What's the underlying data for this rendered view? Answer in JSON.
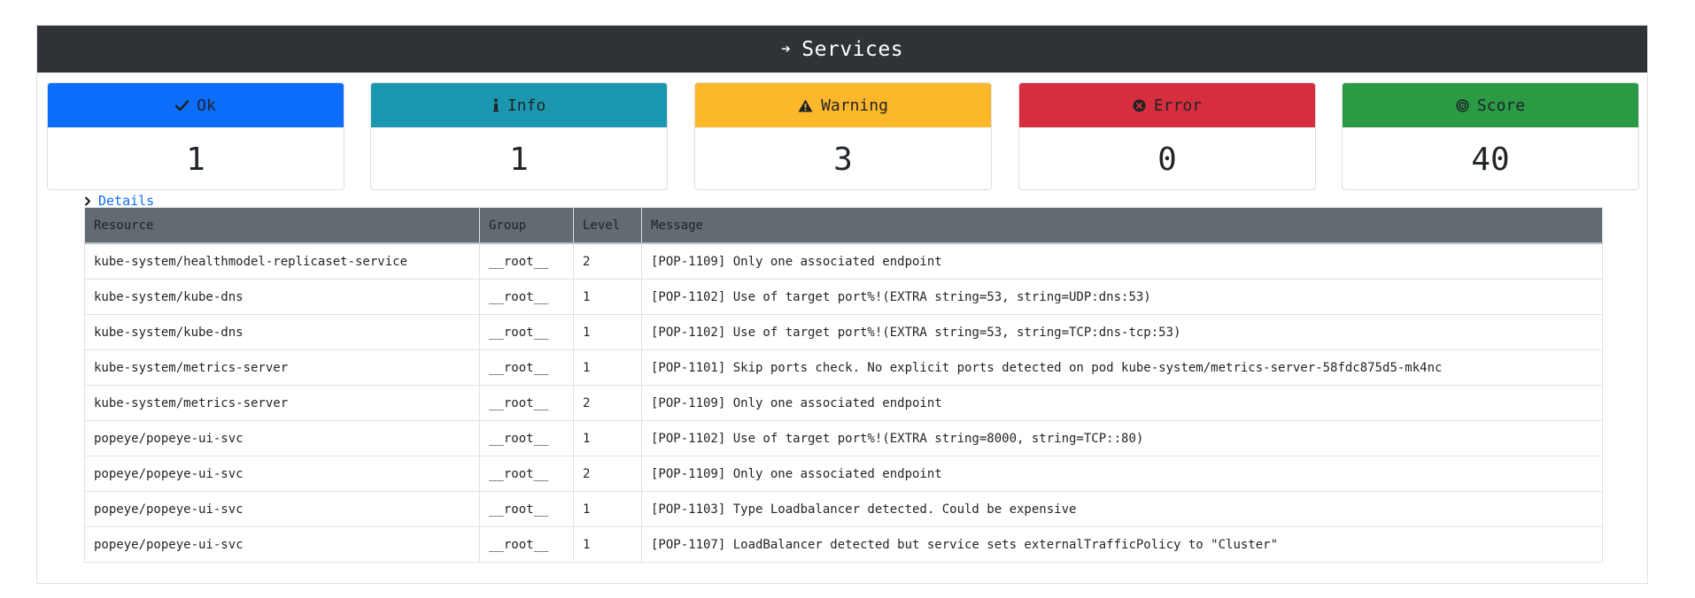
{
  "panel": {
    "title": "Services",
    "title_icon": "arrow-right-icon"
  },
  "cards": [
    {
      "label": "Ok",
      "value": "1",
      "icon": "check-icon",
      "color": "#0d6efd",
      "text_color": "#1f2326"
    },
    {
      "label": "Info",
      "value": "1",
      "icon": "info-icon",
      "color": "#1b98b0",
      "text_color": "#1f2326"
    },
    {
      "label": "Warning",
      "value": "3",
      "icon": "warning-triangle-icon",
      "color": "#fdb72b",
      "text_color": "#1f2326"
    },
    {
      "label": "Error",
      "value": "0",
      "icon": "circle-x-icon",
      "color": "#d62e3e",
      "text_color": "#1f2326"
    },
    {
      "label": "Score",
      "value": "40",
      "icon": "target-icon",
      "color": "#2a9a45",
      "text_color": "#1f2326"
    }
  ],
  "details": {
    "label": "Details",
    "icon": "chevron-right-icon"
  },
  "table": {
    "columns": [
      "Resource",
      "Group",
      "Level",
      "Message"
    ],
    "rows": [
      {
        "resource": "kube-system/healthmodel-replicaset-service",
        "group": "__root__",
        "level": "2",
        "message": "[POP-1109] Only one associated endpoint"
      },
      {
        "resource": "kube-system/kube-dns",
        "group": "__root__",
        "level": "1",
        "message": "[POP-1102] Use of target port%!(EXTRA string=53, string=UDP:dns:53)"
      },
      {
        "resource": "kube-system/kube-dns",
        "group": "__root__",
        "level": "1",
        "message": "[POP-1102] Use of target port%!(EXTRA string=53, string=TCP:dns-tcp:53)"
      },
      {
        "resource": "kube-system/metrics-server",
        "group": "__root__",
        "level": "1",
        "message": "[POP-1101] Skip ports check. No explicit ports detected on pod kube-system/metrics-server-58fdc875d5-mk4nc"
      },
      {
        "resource": "kube-system/metrics-server",
        "group": "__root__",
        "level": "2",
        "message": "[POP-1109] Only one associated endpoint"
      },
      {
        "resource": "popeye/popeye-ui-svc",
        "group": "__root__",
        "level": "1",
        "message": "[POP-1102] Use of target port%!(EXTRA string=8000, string=TCP::80)"
      },
      {
        "resource": "popeye/popeye-ui-svc",
        "group": "__root__",
        "level": "2",
        "message": "[POP-1109] Only one associated endpoint"
      },
      {
        "resource": "popeye/popeye-ui-svc",
        "group": "__root__",
        "level": "1",
        "message": "[POP-1103] Type Loadbalancer detected. Could be expensive"
      },
      {
        "resource": "popeye/popeye-ui-svc",
        "group": "__root__",
        "level": "1",
        "message": "[POP-1107] LoadBalancer detected but service sets externalTrafficPolicy to \"Cluster\""
      }
    ]
  }
}
